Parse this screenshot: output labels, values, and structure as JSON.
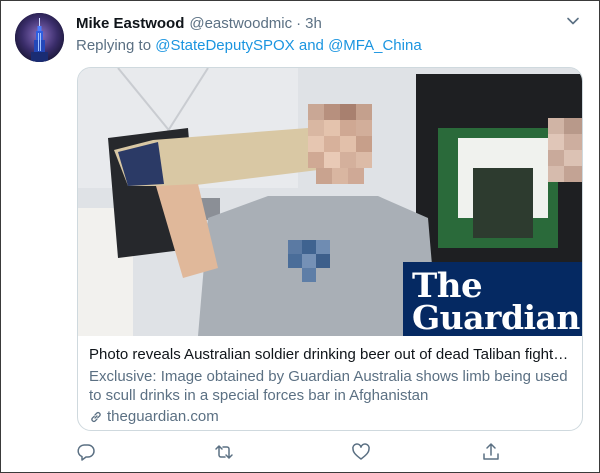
{
  "tweet": {
    "author_name": "Mike Eastwood",
    "author_handle": "@eastwoodmic",
    "separator": "·",
    "time": "3h",
    "reply_prefix": "Replying to",
    "mention_1": "@StateDeputySPOX",
    "reply_and": "and",
    "mention_2": "@MFA_China"
  },
  "card": {
    "image_logo_line1": "The",
    "image_logo_line2": "Guardian",
    "title": "Photo reveals Australian soldier drinking beer out of dead Taliban fighte...",
    "description": "Exclusive: Image obtained by Guardian Australia shows limb being used to scull drinks in a special forces bar in Afghanistan",
    "domain": "theguardian.com"
  },
  "icons": {
    "avatar": "empire-state-building-avatar",
    "caret": "chevron-down-icon",
    "reply": "reply-icon",
    "retweet": "retweet-icon",
    "like": "heart-icon",
    "share": "share-icon",
    "link": "link-icon"
  },
  "colors": {
    "link_blue": "#1b95e0",
    "muted_text": "#5b7083",
    "guardian_navy": "#052962"
  }
}
